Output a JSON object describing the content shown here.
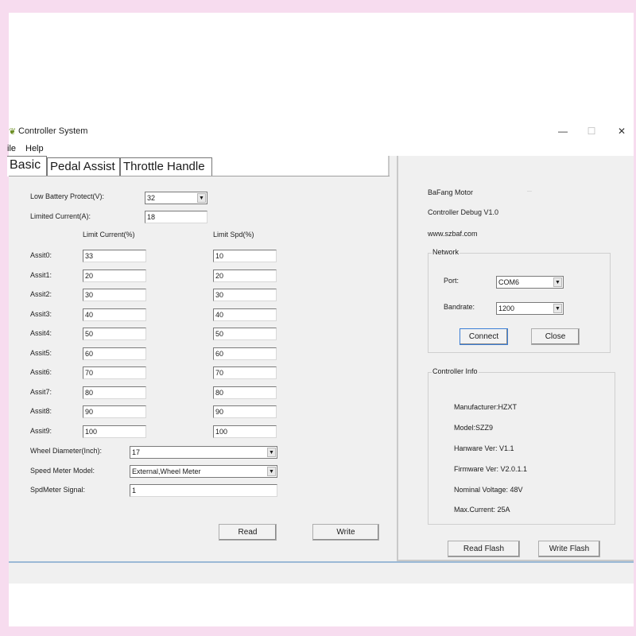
{
  "window": {
    "title": "Controller System",
    "controls": {
      "minimize": "—",
      "maximize": "☐",
      "close": "✕"
    }
  },
  "menu": [
    "ile",
    "Help"
  ],
  "tabs": [
    "Basic",
    "Pedal Assist",
    "Throttle Handle"
  ],
  "basic": {
    "low_battery_label": "Low Battery Protect(V):",
    "low_battery_value": "32",
    "limited_current_label": "Limited Current(A):",
    "limited_current_value": "18",
    "col_limit_current": "Limit Current(%)",
    "col_limit_speed": "Limit Spd(%)",
    "assists": [
      {
        "label": "Assit0:",
        "current": "33",
        "speed": "10"
      },
      {
        "label": "Assit1:",
        "current": "20",
        "speed": "20"
      },
      {
        "label": "Assit2:",
        "current": "30",
        "speed": "30"
      },
      {
        "label": "Assit3:",
        "current": "40",
        "speed": "40"
      },
      {
        "label": "Assit4:",
        "current": "50",
        "speed": "50"
      },
      {
        "label": "Assit5:",
        "current": "60",
        "speed": "60"
      },
      {
        "label": "Assit6:",
        "current": "70",
        "speed": "70"
      },
      {
        "label": "Assit7:",
        "current": "80",
        "speed": "80"
      },
      {
        "label": "Assit8:",
        "current": "90",
        "speed": "90"
      },
      {
        "label": "Assit9:",
        "current": "100",
        "speed": "100"
      }
    ],
    "wheel_diameter_label": "Wheel Diameter(Inch):",
    "wheel_diameter_value": "17",
    "speed_meter_label": "Speed Meter Model:",
    "speed_meter_value": "External,Wheel Meter",
    "spd_signal_label": "SpdMeter Signal:",
    "spd_signal_value": "1",
    "read_button": "Read",
    "write_button": "Write"
  },
  "info": {
    "brand": "BaFang Motor",
    "debug": "Controller Debug V1.0",
    "website": "www.szbaf.com"
  },
  "network": {
    "title": "Network",
    "port_label": "Port:",
    "port_value": "COM6",
    "baud_label": "Bandrate:",
    "baud_value": "1200",
    "connect_button": "Connect",
    "close_button": "Close"
  },
  "controller_info": {
    "title": "Controller Info",
    "manufacturer": "Manufacturer:HZXT",
    "model": "Model:SZZ9",
    "hardware": "Hanware Ver: V1.1",
    "firmware": "Firmware Ver: V2.0.1.1",
    "voltage": "Nominal Voltage: 48V",
    "max_current": "Max.Current: 25A"
  },
  "flash": {
    "read_flash": "Read Flash",
    "write_flash": "Write Flash"
  },
  "icons": {
    "app": "app-leaf-icon",
    "dropdown": "chevron-down-icon"
  },
  "colors": {
    "background": "#f7dcef",
    "window": "#f0f0f0",
    "accent_line": "#9bb9d6"
  }
}
